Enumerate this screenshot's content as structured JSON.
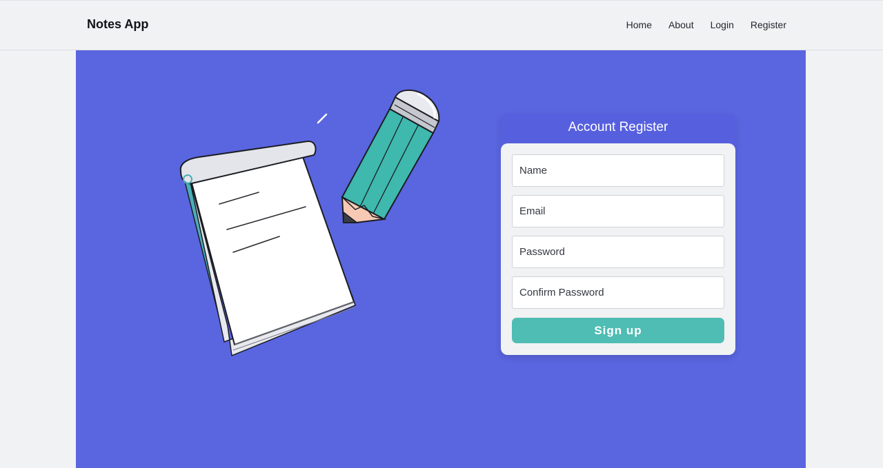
{
  "navbar": {
    "brand": "Notes App",
    "links": [
      {
        "label": "Home"
      },
      {
        "label": "About"
      },
      {
        "label": "Login"
      },
      {
        "label": "Register"
      }
    ]
  },
  "illustration": {
    "icon": "notebook-pencil-illustration"
  },
  "form": {
    "title": "Account Register",
    "fields": [
      {
        "placeholder": "Name",
        "value": ""
      },
      {
        "placeholder": "Email",
        "value": ""
      },
      {
        "placeholder": "Password",
        "value": ""
      },
      {
        "placeholder": "Confirm Password",
        "value": ""
      }
    ],
    "submit_label": "Sign up"
  },
  "colors": {
    "hero_bg": "#5a65e0",
    "accent": "#4fbdb3",
    "nav_bg": "#f1f2f4"
  }
}
